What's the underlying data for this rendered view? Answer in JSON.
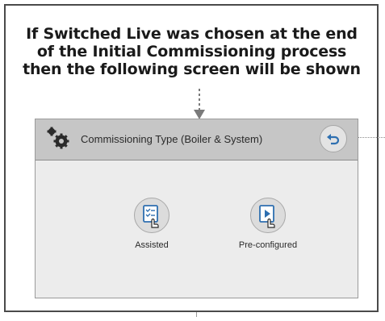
{
  "caption": {
    "line1": "If Switched Live was chosen at the end",
    "line2": "of the Initial Commissioning process",
    "line3": "then the following screen will be shown"
  },
  "screen": {
    "title": "Commissioning Type (Boiler & System)",
    "options": [
      {
        "label": "Assisted",
        "icon": "checklist-touch-icon"
      },
      {
        "label": "Pre-configured",
        "icon": "play-touch-icon"
      }
    ],
    "back_icon": "back-arrow-icon",
    "settings_icon": "gear-icon"
  },
  "colors": {
    "header_bg": "#c6c6c6",
    "screen_bg": "#ececec",
    "accent_blue": "#2e6fb0"
  }
}
